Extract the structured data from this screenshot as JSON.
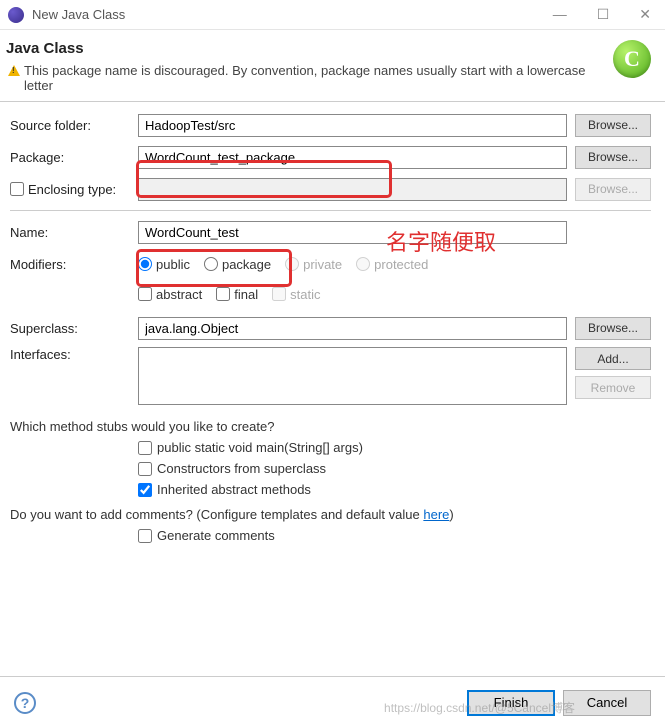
{
  "titlebar": {
    "title": "New Java Class"
  },
  "header": {
    "title": "Java Class",
    "warning": "This package name is discouraged. By convention, package names usually start with a lowercase letter",
    "icon_letter": "C"
  },
  "form": {
    "source_folder_label": "Source folder:",
    "source_folder_value": "HadoopTest/src",
    "package_label": "Package:",
    "package_value": "WordCount_test_package",
    "enclosing_type_label": "Enclosing type:",
    "enclosing_type_value": "",
    "name_label": "Name:",
    "name_value": "WordCount_test",
    "modifiers_label": "Modifiers:",
    "radio_public": "public",
    "radio_package": "package",
    "radio_private": "private",
    "radio_protected": "protected",
    "cb_abstract": "abstract",
    "cb_final": "final",
    "cb_static": "static",
    "superclass_label": "Superclass:",
    "superclass_value": "java.lang.Object",
    "interfaces_label": "Interfaces:",
    "browse_label": "Browse...",
    "add_label": "Add...",
    "remove_label": "Remove"
  },
  "stubs": {
    "question": "Which method stubs would you like to create?",
    "cb_main": "public static void main(String[] args)",
    "cb_constructors": "Constructors from superclass",
    "cb_inherited": "Inherited abstract methods",
    "comments_q1": "Do you want to add comments? (Configure templates and default value ",
    "comments_link": "here",
    "comments_q2": ")",
    "cb_generate": "Generate comments"
  },
  "footer": {
    "finish": "Finish",
    "cancel": "Cancel"
  },
  "annotation": {
    "red_text": "名字随便取"
  },
  "watermark": "https://blog.csdn.net/@5Cancel博客"
}
